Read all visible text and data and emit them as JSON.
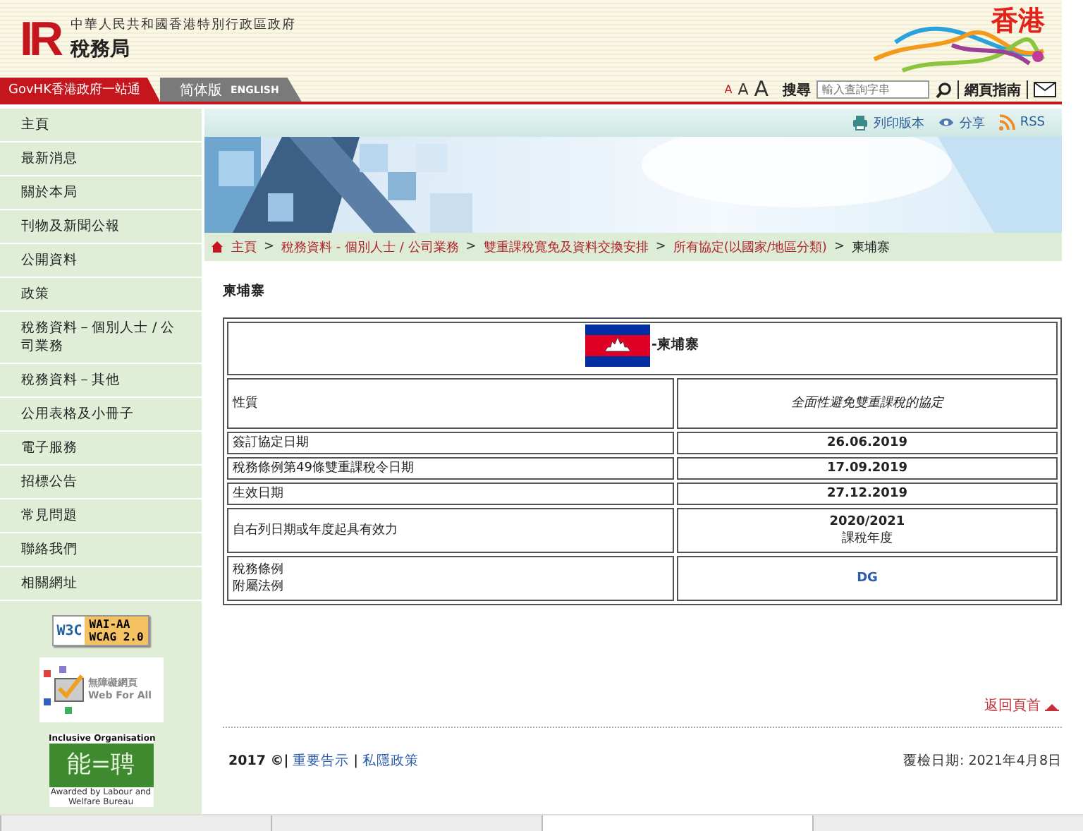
{
  "header": {
    "logo_mark": "IR",
    "agency_line": "中華人民共和國香港特別行政區政府",
    "agency_name": "稅務局",
    "brand": "香港"
  },
  "nav": {
    "portal": "GovHK香港政府一站通",
    "languages": [
      "简体版",
      "ENGLISH"
    ],
    "font_sizes": [
      "A",
      "A",
      "A"
    ],
    "search_label": "搜尋",
    "search_placeholder": "輸入查詢字串",
    "guide": "網頁指南"
  },
  "page_tools": [
    {
      "kind": "print",
      "label": "列印版本"
    },
    {
      "kind": "share",
      "label": "分享"
    },
    {
      "kind": "rss",
      "label": "RSS"
    }
  ],
  "sidebar": {
    "items": [
      "主頁",
      "最新消息",
      "關於本局",
      "刊物及新聞公報",
      "公開資料",
      "政策",
      "稅務資料－個別人士 / 公司業務",
      "稅務資料－其他",
      "公用表格及小冊子",
      "電子服務",
      "招標公告",
      "常見問題",
      "聯絡我們",
      "相關網址"
    ],
    "badges": [
      {
        "kind": "w3c",
        "lines": [
          "W3C",
          "WAI-AA",
          "WCAG 2.0"
        ]
      },
      {
        "kind": "webforall",
        "lines": [
          "無障礙網頁",
          "Web For All"
        ]
      },
      {
        "kind": "inclusive",
        "lines": [
          "Inclusive Organisation",
          "能=聘",
          "Awarded by Labour and Welfare Bureau"
        ]
      }
    ]
  },
  "breadcrumb": {
    "links": [
      "主頁",
      "稅務資料 - 個別人士 / 公司業務",
      "雙重課稅寬免及資料交換安排",
      "所有協定(以國家/地區分類)"
    ],
    "separator": ">",
    "current": "柬埔寨"
  },
  "heading": "柬埔寨",
  "table": {
    "title": "-柬埔寨",
    "rows": [
      {
        "label": [
          "性質"
        ],
        "value": [
          {
            "text": "全面性避免雙重課稅的協定",
            "kind": "italic"
          }
        ]
      },
      {
        "label": [
          "簽訂協定日期"
        ],
        "value": [
          {
            "text": "26.06.2019",
            "kind": "bold"
          }
        ]
      },
      {
        "label": [
          "稅務條例第49條雙重課稅令日期"
        ],
        "value": [
          {
            "text": "17.09.2019",
            "kind": "bold"
          }
        ]
      },
      {
        "label": [
          "生效日期"
        ],
        "value": [
          {
            "text": "27.12.2019",
            "kind": "bold"
          }
        ]
      },
      {
        "label": [
          "自右列日期或年度起具有效力"
        ],
        "value": [
          {
            "text": "2020/2021",
            "kind": "bold"
          },
          {
            "text": "課稅年度",
            "kind": "plain"
          }
        ]
      },
      {
        "label": [
          "稅務條例",
          "附屬法例"
        ],
        "value": [
          {
            "text": "DG",
            "kind": "link"
          }
        ]
      }
    ]
  },
  "back_to_top": "返回頁首",
  "footer": {
    "copyright": "2017 ©|",
    "links": [
      "重要告示",
      "私隱政策"
    ],
    "separator": "|",
    "review_date": "覆檢日期: 2021年4月8日"
  }
}
